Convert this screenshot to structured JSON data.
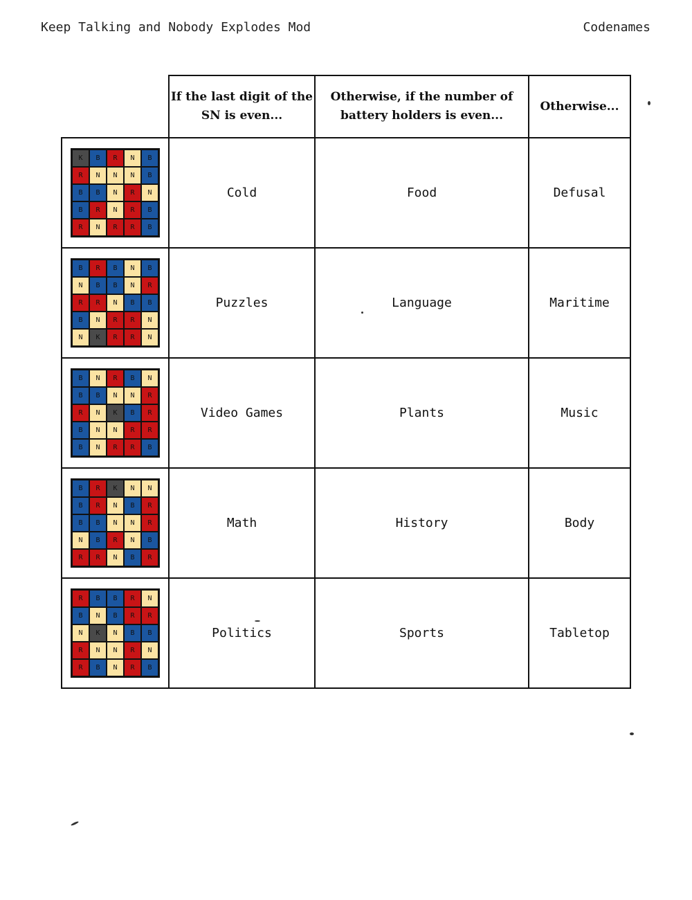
{
  "header": {
    "left": "Keep Talking and Nobody Explodes Mod",
    "right": "Codenames"
  },
  "columns": [
    "If the last digit of the SN is even...",
    "Otherwise, if the number of battery holders is even...",
    "Otherwise..."
  ],
  "rows": [
    {
      "grid": [
        [
          "K",
          "B",
          "R",
          "N",
          "B"
        ],
        [
          "R",
          "N",
          "N",
          "N",
          "B"
        ],
        [
          "B",
          "B",
          "N",
          "R",
          "N"
        ],
        [
          "B",
          "R",
          "N",
          "R",
          "B"
        ],
        [
          "R",
          "N",
          "R",
          "R",
          "B"
        ]
      ],
      "words": [
        "Cold",
        "Food",
        "Defusal"
      ]
    },
    {
      "grid": [
        [
          "B",
          "R",
          "B",
          "N",
          "B"
        ],
        [
          "N",
          "B",
          "B",
          "N",
          "R"
        ],
        [
          "R",
          "R",
          "N",
          "B",
          "B"
        ],
        [
          "B",
          "N",
          "R",
          "R",
          "N"
        ],
        [
          "N",
          "K",
          "R",
          "R",
          "N"
        ]
      ],
      "words": [
        "Puzzles",
        "Language",
        "Maritime"
      ]
    },
    {
      "grid": [
        [
          "B",
          "N",
          "R",
          "B",
          "N"
        ],
        [
          "B",
          "B",
          "N",
          "N",
          "R"
        ],
        [
          "R",
          "N",
          "K",
          "B",
          "R"
        ],
        [
          "B",
          "N",
          "N",
          "R",
          "R"
        ],
        [
          "B",
          "N",
          "R",
          "R",
          "B"
        ]
      ],
      "words": [
        "Video Games",
        "Plants",
        "Music"
      ]
    },
    {
      "grid": [
        [
          "B",
          "R",
          "K",
          "N",
          "N"
        ],
        [
          "B",
          "R",
          "N",
          "B",
          "R"
        ],
        [
          "B",
          "B",
          "N",
          "N",
          "R"
        ],
        [
          "N",
          "B",
          "R",
          "N",
          "B"
        ],
        [
          "R",
          "R",
          "N",
          "B",
          "R"
        ]
      ],
      "words": [
        "Math",
        "History",
        "Body"
      ]
    },
    {
      "grid": [
        [
          "R",
          "B",
          "B",
          "R",
          "N"
        ],
        [
          "B",
          "N",
          "B",
          "R",
          "R"
        ],
        [
          "N",
          "K",
          "N",
          "B",
          "B"
        ],
        [
          "R",
          "N",
          "N",
          "R",
          "N"
        ],
        [
          "R",
          "B",
          "N",
          "R",
          "B"
        ]
      ],
      "words": [
        "Politics",
        "Sports",
        "Tabletop"
      ]
    }
  ],
  "colors": {
    "K": "#4a4a4a",
    "B": "#1b56a0",
    "R": "#c81416",
    "N": "#fbe3a3"
  }
}
